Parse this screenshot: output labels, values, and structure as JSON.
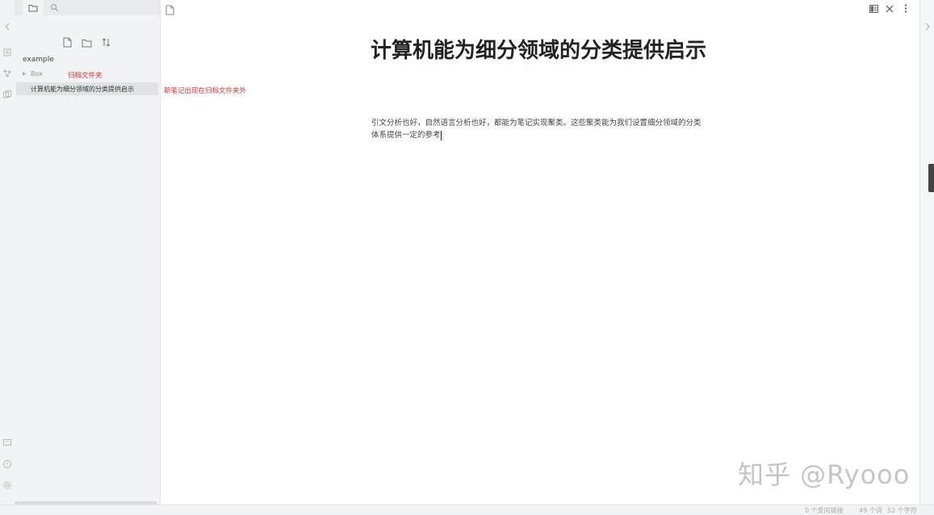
{
  "ribbon": {
    "icons": [
      "collapse-left-icon",
      "quick-switcher-icon",
      "graph-view-icon",
      "templates-icon",
      "vault-icon",
      "help-icon",
      "settings-icon"
    ]
  },
  "sidebar": {
    "tabs": [
      "folder-icon",
      "search-icon"
    ],
    "actions": [
      "new-note-icon",
      "new-folder-icon",
      "sort-icon"
    ],
    "vault_name": "example",
    "folder": {
      "name": "Box",
      "collapsed": true
    },
    "archive_annotation": "归档文件夹",
    "file": {
      "name": "计算机能为细分领域的分类提供启示"
    }
  },
  "annotation_new_note": "新笔记出现在归档文件夹外",
  "editor": {
    "title": "计算机能为细分领域的分类提供启示",
    "body": "引文分析也好，自然语言分析也好，都能为笔记实现聚类。这些聚类能为我们设置细分领域的分类体系提供一定的参考"
  },
  "header_actions": [
    "reading-mode-icon",
    "close-icon",
    "more-options-icon"
  ],
  "watermark": "知乎 @Ryooo",
  "status": {
    "backlinks": "0 个反向链接",
    "words": "49 个词",
    "chars": "52 个字符"
  },
  "colors": {
    "annotation": "#e03030",
    "sidebar_bg": "#f2f3f5",
    "selected_file_bg": "#e1e2e5"
  }
}
